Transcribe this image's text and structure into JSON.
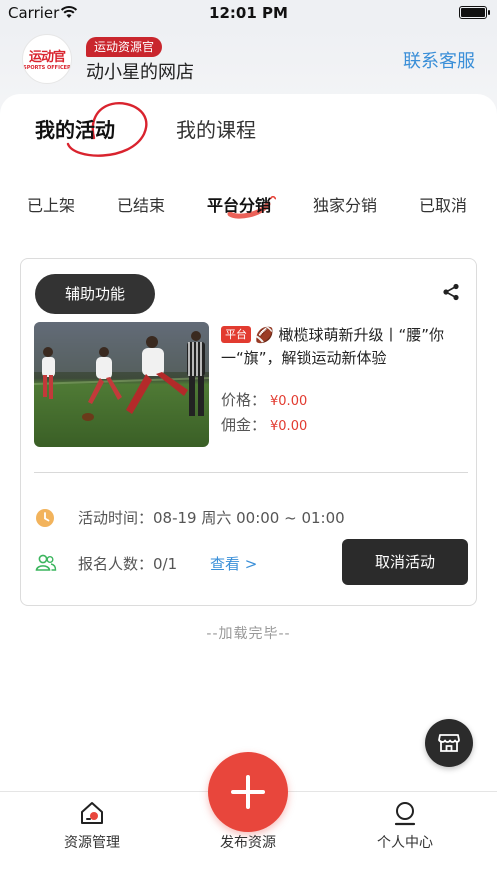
{
  "status_bar": {
    "carrier": "Carrier",
    "time": "12:01 PM"
  },
  "header": {
    "logo_text": "运动官",
    "logo_subtext": "SPORTS OFFICER",
    "role_badge": "运动资源官",
    "shop_name": "动小星的网店",
    "contact_label": "联系客服"
  },
  "main_tabs": [
    {
      "label": "我的活动",
      "active": true
    },
    {
      "label": "我的课程",
      "active": false
    }
  ],
  "sub_tabs": [
    {
      "label": "已上架",
      "active": false
    },
    {
      "label": "已结束",
      "active": false
    },
    {
      "label": "平台分销",
      "active": true
    },
    {
      "label": "独家分销",
      "active": false
    },
    {
      "label": "已取消",
      "active": false
    }
  ],
  "activity_card": {
    "aux_button": "辅助功能",
    "tag": "平台",
    "title": "🏈 橄榄球萌新升级丨“腰”你一“旗”，解锁运动新体验",
    "price_label": "价格：",
    "price_value": "¥0.00",
    "commission_label": "佣金：",
    "commission_value": "¥0.00",
    "time_text": "活动时间：08-19 周六 00:00 ~ 01:00",
    "signup_text": "报名人数：0/1",
    "view_link": "查看 >",
    "cancel_button": "取消活动"
  },
  "list_footer": "--加载完毕--",
  "tab_bar": {
    "left_label": "资源管理",
    "center_label": "发布资源",
    "right_label": "个人中心"
  },
  "colors": {
    "accent_red": "#e8463c",
    "link_blue": "#3a8fd8",
    "dark": "#2b2b2b"
  }
}
